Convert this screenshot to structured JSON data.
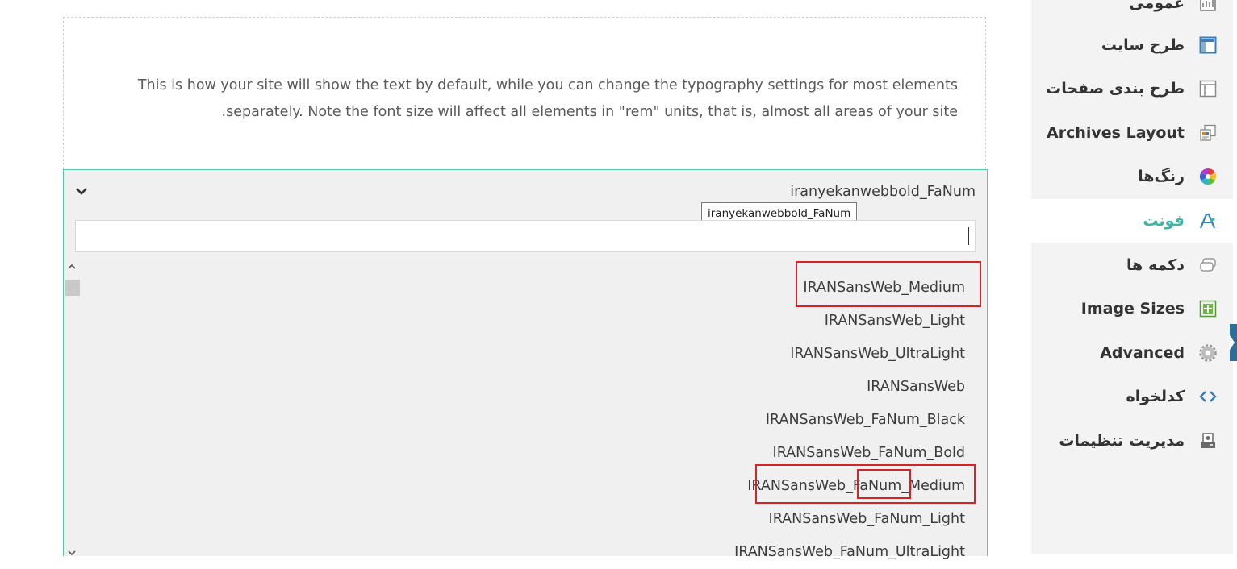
{
  "description": "This is how your site will show the text by default, while you can change the typography settings for most elements separately. Note the font size will affect all elements in \"rem\" units, that is, almost all areas of your site.",
  "font_select": {
    "selected": "iranyekanwebbold_FaNum",
    "tooltip": "iranyekanwebbold_FaNum",
    "search_value": "",
    "options": [
      "IRANSansWeb_Medium",
      "IRANSansWeb_Light",
      "IRANSansWeb_UltraLight",
      "IRANSansWeb",
      "IRANSansWeb_FaNum_Black",
      "IRANSansWeb_FaNum_Bold",
      "IRANSansWeb_FaNum_Medium",
      "IRANSansWeb_FaNum_Light",
      "IRANSansWeb_FaNum_UltraLight"
    ]
  },
  "sidebar": {
    "items": [
      {
        "label": "عمومی",
        "icon": "general-icon"
      },
      {
        "label": "طرح سایت",
        "icon": "site-layout-icon"
      },
      {
        "label": "طرح بندی صفحات",
        "icon": "page-layout-icon"
      },
      {
        "label": "Archives Layout",
        "icon": "archives-layout-icon"
      },
      {
        "label": "رنگ‌ها",
        "icon": "color-wheel-icon"
      },
      {
        "label": "فونت",
        "icon": "font-icon",
        "active": true
      },
      {
        "label": "دکمه ها",
        "icon": "buttons-icon"
      },
      {
        "label": "Image Sizes",
        "icon": "image-sizes-icon"
      },
      {
        "label": "Advanced",
        "icon": "gear-icon"
      },
      {
        "label": "کدلخواه",
        "icon": "code-icon"
      },
      {
        "label": "مدیریت تنظیمات",
        "icon": "settings-manager-icon"
      }
    ]
  },
  "colors": {
    "accent": "#3eb5a3",
    "highlight_border": "#d42424",
    "sidebar_bg": "#f3f3f3"
  }
}
